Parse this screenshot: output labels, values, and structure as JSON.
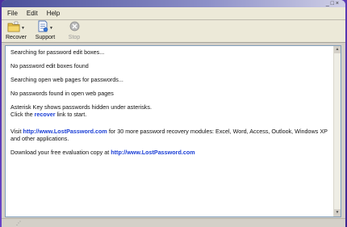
{
  "window": {
    "title": "",
    "controls": "_ □ ×"
  },
  "menu": [
    "File",
    "Edit",
    "Help"
  ],
  "toolbar": {
    "recover_label": "Recover",
    "support_label": "Support",
    "stop_label": "Stop"
  },
  "log": {
    "line1": "Searching for password edit boxes...",
    "line2": "No password edit boxes found",
    "line3": "Searching open web pages for passwords...",
    "line4": "No passwords found in open web pages",
    "info1": "Asterisk Key shows passwords hidden under asterisks.",
    "info2_pre": "Click the",
    "info2_link": "recover",
    "info2_post": "link to start.",
    "visit_pre": "Visit",
    "visit_link": "http://www.LostPassword.com",
    "visit_post": "for 30 more password recovery modules: Excel, Word, Access, Outlook, Windows XP and other applications.",
    "download_pre": "Download your free evaluation copy at",
    "download_link": "http://www.LostPassword.com"
  },
  "colors": {
    "link": "#1a3ed6",
    "background": "#6a45c8"
  }
}
